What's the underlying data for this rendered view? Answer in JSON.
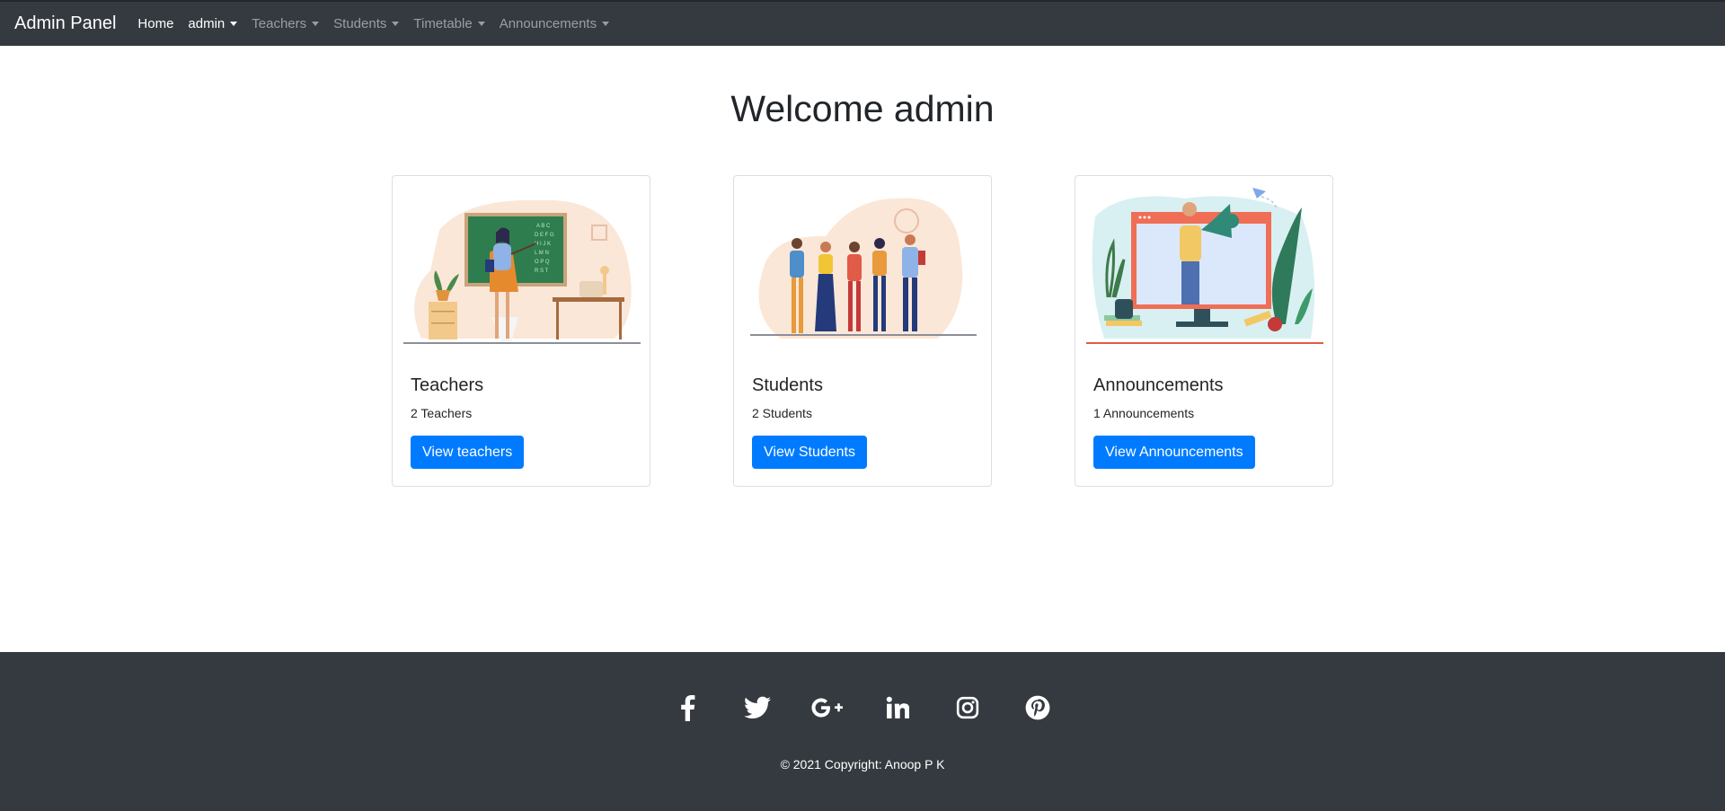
{
  "navbar": {
    "brand": "Admin Panel",
    "items": [
      {
        "label": "Home",
        "dropdown": false,
        "active": true
      },
      {
        "label": "admin",
        "dropdown": true,
        "active": true
      },
      {
        "label": "Teachers",
        "dropdown": true,
        "active": false
      },
      {
        "label": "Students",
        "dropdown": true,
        "active": false
      },
      {
        "label": "Timetable",
        "dropdown": true,
        "active": false
      },
      {
        "label": "Announcements",
        "dropdown": true,
        "active": false
      }
    ]
  },
  "main": {
    "title": "Welcome admin",
    "cards": [
      {
        "illustration": "teacher-classroom-illustration",
        "title": "Teachers",
        "count": "2 Teachers",
        "button": "View teachers"
      },
      {
        "illustration": "students-group-illustration",
        "title": "Students",
        "count": "2 Students",
        "button": "View Students"
      },
      {
        "illustration": "megaphone-announcement-illustration",
        "title": "Announcements",
        "count": "1 Announcements",
        "button": "View Announcements"
      }
    ]
  },
  "footer": {
    "social_icons": [
      "facebook-icon",
      "twitter-icon",
      "google-plus-icon",
      "linkedin-icon",
      "instagram-icon",
      "pinterest-icon"
    ],
    "copyright": "© 2021 Copyright: Anoop P K"
  },
  "colors": {
    "navbar_bg": "#343a40",
    "primary": "#007bff",
    "footer_bg": "#343a40"
  }
}
